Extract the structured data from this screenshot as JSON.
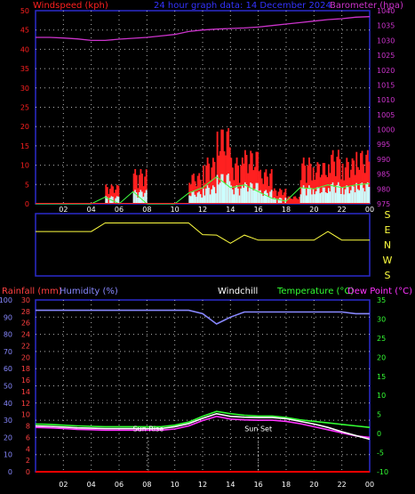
{
  "header": {
    "left": "Windspeed (kph)",
    "center": "24 hour graph data: 14 December 2024",
    "right": "Barometer (hpa)"
  },
  "colors": {
    "background": "#000000",
    "panel_border": "#2a2acc",
    "grid": "#ffffff",
    "windspeed": "#ff2020",
    "gust": "#ff0000",
    "wind_avg": "#40ff40",
    "wind_light": "#ccffff",
    "barometer": "#cc33cc",
    "direction": "#ffff40",
    "rainfall": "#ff0000",
    "humidity": "#8888ff",
    "windchill": "#ffffff",
    "temperature": "#33ff33",
    "dewpoint": "#ff33ff",
    "rain_axis_text": "#ff4040",
    "humidity_axis_text": "#8888ff",
    "temp_axis_text": "#33ff33",
    "sun_text": "#ffffff"
  },
  "x_ticks": [
    "02",
    "04",
    "06",
    "08",
    "10",
    "12",
    "14",
    "16",
    "18",
    "20",
    "22",
    "00"
  ],
  "chart_data": [
    {
      "type": "line",
      "x": [
        0,
        1,
        2,
        3,
        4,
        5,
        6,
        7,
        8,
        9,
        10,
        11,
        12,
        13,
        14,
        15,
        16,
        17,
        18,
        19,
        20,
        21,
        22,
        23,
        24
      ],
      "x_tick_labels": [
        "02",
        "04",
        "06",
        "08",
        "10",
        "12",
        "14",
        "16",
        "18",
        "20",
        "22",
        "00"
      ],
      "left_axis": {
        "label": "Windspeed (kph)",
        "ylim": [
          0,
          50
        ],
        "ticks": [
          0,
          5,
          10,
          15,
          20,
          25,
          30,
          35,
          40,
          45,
          50
        ]
      },
      "right_axis": {
        "label": "Barometer (hpa)",
        "ylim": [
          975,
          1040
        ],
        "ticks": [
          975,
          980,
          985,
          990,
          995,
          1000,
          1005,
          1010,
          1015,
          1020,
          1025,
          1030,
          1035,
          1040
        ]
      },
      "series": [
        {
          "name": "Windspeed (kph)",
          "axis": "left",
          "values": [
            0,
            0,
            0,
            0,
            0,
            5,
            0,
            9,
            0,
            0,
            0,
            8,
            12,
            20,
            12,
            14,
            9,
            4,
            2,
            12,
            11,
            14,
            12,
            14,
            15
          ]
        },
        {
          "name": "Barometer (hpa)",
          "axis": "right",
          "values": [
            1031,
            1031,
            1030.8,
            1030.5,
            1030,
            1030,
            1030.4,
            1030.7,
            1031,
            1031.5,
            1032,
            1033,
            1033.5,
            1033.8,
            1034,
            1034.2,
            1034.5,
            1035,
            1035.5,
            1036,
            1036.5,
            1037,
            1037.3,
            1037.8,
            1038
          ]
        }
      ],
      "title": "24 hour graph data: 14 December 2024"
    },
    {
      "type": "line",
      "x": [
        0,
        1,
        2,
        3,
        4,
        5,
        6,
        7,
        8,
        9,
        10,
        11,
        12,
        13,
        14,
        15,
        16,
        17,
        18,
        19,
        20,
        21,
        22,
        23,
        24
      ],
      "compass_labels": [
        "S",
        "E",
        "N",
        "W",
        "S"
      ],
      "series": [
        {
          "name": "Wind direction",
          "values": [
            "E",
            "E",
            "E",
            "E",
            "E",
            "S",
            "S",
            "S",
            "S",
            "S",
            "S",
            "S",
            "E",
            "N",
            "N",
            "N",
            "N",
            "N",
            "N",
            "N",
            "N",
            "E",
            "N",
            "N",
            "N"
          ]
        }
      ]
    },
    {
      "type": "line",
      "x": [
        0,
        1,
        2,
        3,
        4,
        5,
        6,
        7,
        8,
        9,
        10,
        11,
        12,
        13,
        14,
        15,
        16,
        17,
        18,
        19,
        20,
        21,
        22,
        23,
        24
      ],
      "x_tick_labels": [
        "02",
        "04",
        "06",
        "08",
        "10",
        "12",
        "14",
        "16",
        "18",
        "20",
        "22",
        "00"
      ],
      "axes": {
        "humidity": {
          "label": "Humidity (%)",
          "ylim": [
            0,
            100
          ],
          "ticks": [
            0,
            10,
            20,
            30,
            40,
            50,
            60,
            70,
            80,
            90,
            100
          ]
        },
        "rainfall": {
          "label": "Rainfall (mm)",
          "ylim": [
            0,
            30
          ],
          "ticks": [
            0,
            2,
            4,
            6,
            8,
            10,
            12,
            14,
            16,
            18,
            20,
            22,
            24,
            26,
            28,
            30
          ]
        },
        "temperature": {
          "label": "Temperature (°C)",
          "ylim": [
            -10,
            35
          ],
          "ticks": [
            -10,
            -5,
            0,
            5,
            10,
            15,
            20,
            25,
            30,
            35
          ]
        }
      },
      "labels": {
        "windchill": "Windchill",
        "dewpoint": "Dew Point (°C)"
      },
      "series": [
        {
          "name": "Humidity (%)",
          "axis": "humidity",
          "values": [
            94,
            94,
            94,
            94,
            94,
            94,
            94,
            94,
            94,
            94,
            94,
            94,
            92,
            86,
            90,
            93,
            93,
            93,
            93,
            93,
            93,
            93,
            93,
            92,
            92
          ]
        },
        {
          "name": "Rainfall (mm)",
          "axis": "rainfall",
          "values": [
            0,
            0,
            0,
            0,
            0,
            0,
            0,
            0,
            0,
            0,
            0,
            0,
            0,
            0,
            0,
            0,
            0,
            0,
            0,
            0,
            0,
            0,
            0,
            0,
            0
          ]
        },
        {
          "name": "Temperature (°C)",
          "axis": "temperature",
          "values": [
            2.5,
            2.4,
            2.2,
            2.0,
            1.9,
            1.8,
            1.8,
            1.8,
            1.8,
            1.8,
            2.2,
            3.0,
            4.5,
            5.8,
            5.2,
            4.8,
            4.6,
            4.6,
            4.2,
            3.6,
            3.2,
            2.8,
            2.4,
            2.0,
            1.6
          ]
        },
        {
          "name": "Dew Point (°C)",
          "axis": "temperature",
          "values": [
            1.6,
            1.5,
            1.3,
            1.1,
            1.0,
            0.9,
            0.9,
            0.9,
            0.9,
            0.9,
            1.2,
            2.0,
            3.4,
            4.5,
            3.8,
            3.6,
            3.5,
            3.5,
            3.2,
            2.6,
            1.8,
            1.0,
            0.2,
            -0.6,
            -1.0
          ]
        },
        {
          "name": "Windchill",
          "axis": "temperature",
          "values": [
            2.0,
            1.9,
            1.7,
            1.5,
            1.4,
            1.3,
            1.3,
            1.3,
            1.3,
            1.3,
            1.8,
            2.6,
            4.0,
            5.2,
            4.5,
            4.3,
            4.2,
            4.2,
            3.9,
            3.2,
            2.5,
            1.6,
            0.5,
            -0.5,
            -1.5
          ]
        }
      ],
      "annotations": [
        {
          "text": "Sun Rise",
          "x": 8.1
        },
        {
          "text": "Sun Set",
          "x": 16.0
        }
      ]
    }
  ]
}
